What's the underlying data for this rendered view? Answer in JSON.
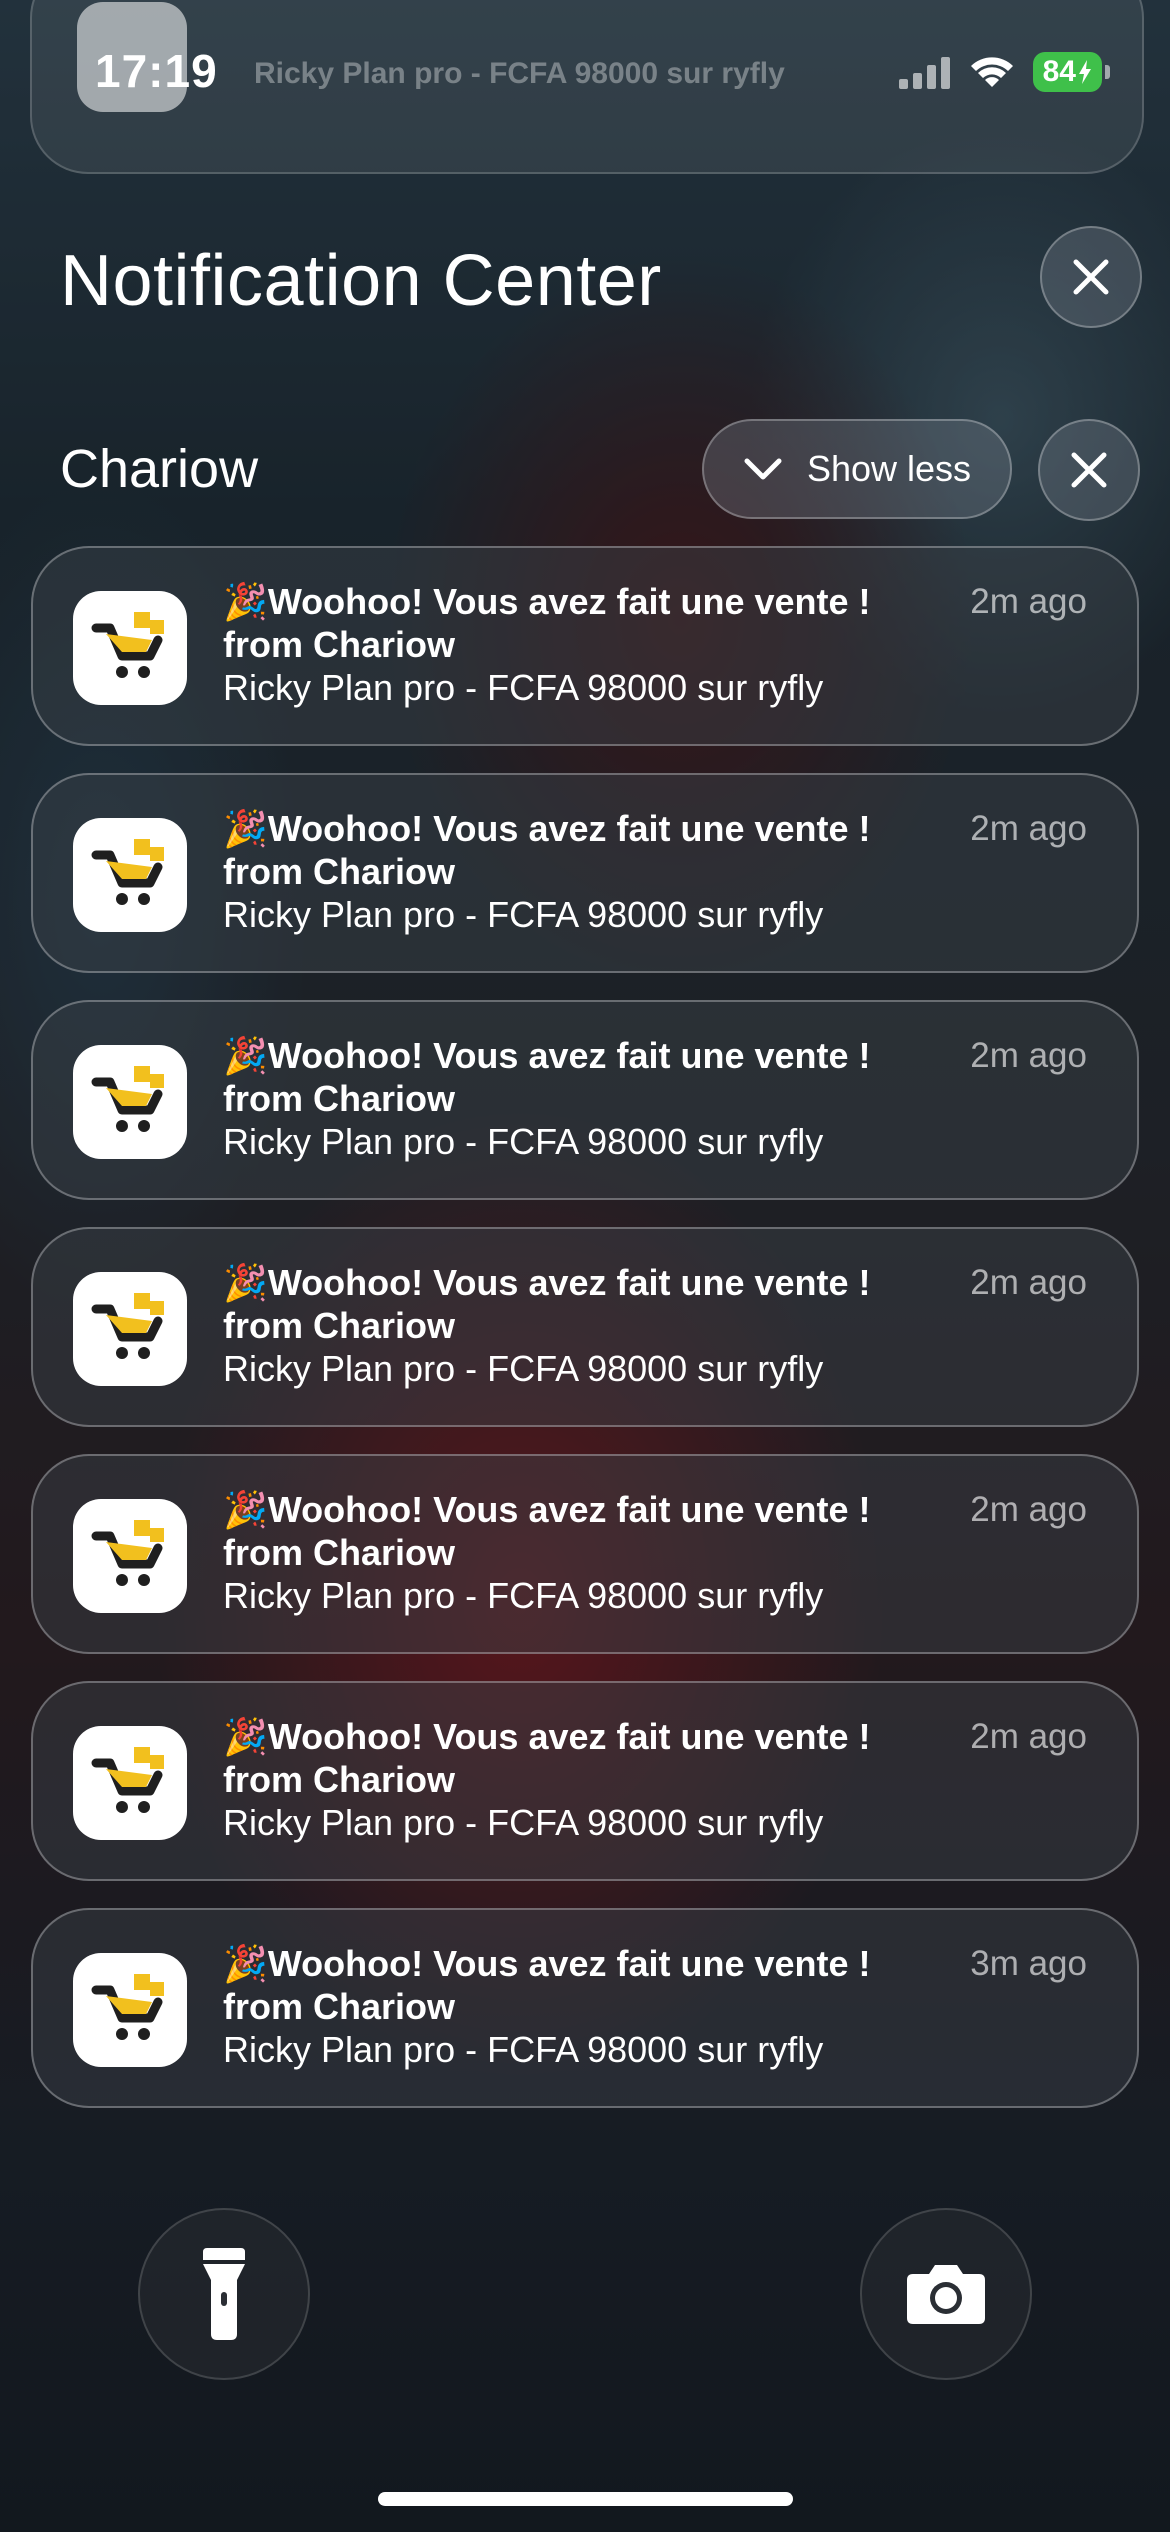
{
  "status_bar": {
    "time": "17:19",
    "battery": "84"
  },
  "ghost_notification": {
    "text": "Ricky Plan pro - FCFA 98000 sur ryfly"
  },
  "header": {
    "title": "Notification Center"
  },
  "group": {
    "app_name": "Chariow",
    "show_less_label": "Show less"
  },
  "notifications": [
    {
      "emoji": "🎉",
      "title": "Woohoo! Vous avez fait une vente !",
      "subtitle": "from Chariow",
      "body": "Ricky Plan pro - FCFA 98000 sur ryfly",
      "time": "2m ago"
    },
    {
      "emoji": "🎉",
      "title": "Woohoo! Vous avez fait une vente !",
      "subtitle": "from Chariow",
      "body": "Ricky Plan pro - FCFA 98000 sur ryfly",
      "time": "2m ago"
    },
    {
      "emoji": "🎉",
      "title": "Woohoo! Vous avez fait une vente !",
      "subtitle": "from Chariow",
      "body": "Ricky Plan pro - FCFA 98000 sur ryfly",
      "time": "2m ago"
    },
    {
      "emoji": "🎉",
      "title": "Woohoo! Vous avez fait une vente !",
      "subtitle": "from Chariow",
      "body": "Ricky Plan pro - FCFA 98000 sur ryfly",
      "time": "2m ago"
    },
    {
      "emoji": "🎉",
      "title": "Woohoo! Vous avez fait une vente !",
      "subtitle": "from Chariow",
      "body": "Ricky Plan pro - FCFA 98000 sur ryfly",
      "time": "2m ago"
    },
    {
      "emoji": "🎉",
      "title": "Woohoo! Vous avez fait une vente !",
      "subtitle": "from Chariow",
      "body": "Ricky Plan pro - FCFA 98000 sur ryfly",
      "time": "2m ago"
    },
    {
      "emoji": "🎉",
      "title": "Woohoo! Vous avez fait une vente !",
      "subtitle": "from Chariow",
      "body": "Ricky Plan pro - FCFA 98000 sur ryfly",
      "time": "3m ago"
    }
  ],
  "icons": {
    "app_icon": "chariow-cart-icon",
    "flashlight": "flashlight-icon",
    "camera": "camera-icon"
  },
  "colors": {
    "battery_green": "#3fc04a",
    "chariow_yellow": "#f2c01e",
    "chariow_dark": "#1f1f1f"
  }
}
